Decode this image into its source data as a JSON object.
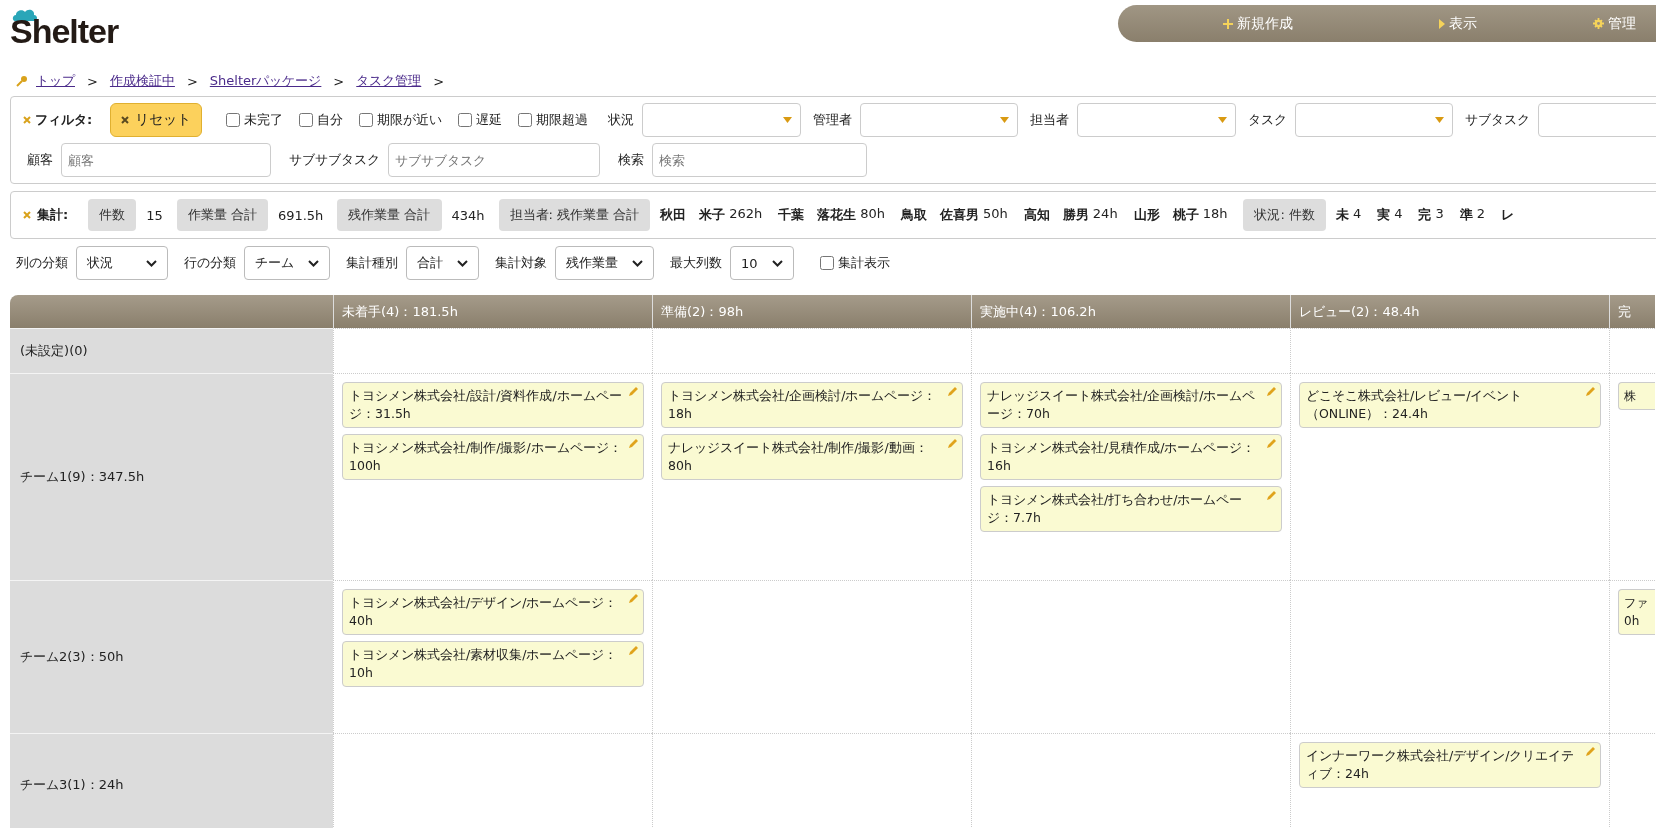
{
  "logo": "Shelter",
  "nav": [
    {
      "kind": "plus",
      "label": "新規作成"
    },
    {
      "kind": "triangle",
      "label": "表示"
    },
    {
      "kind": "gear",
      "label": "管理"
    }
  ],
  "breadcrumb": [
    {
      "label": "トップ",
      "separator": ">"
    },
    {
      "label": "作成検証中",
      "separator": ">"
    },
    {
      "label": "Shelterパッケージ",
      "separator": ">"
    },
    {
      "label": "タスク管理",
      "separator": ">"
    }
  ],
  "filter": {
    "title": "フィルタ:",
    "reset": "リセット",
    "checkboxes": [
      {
        "label": "未完了",
        "checked": false
      },
      {
        "label": "自分",
        "checked": false
      },
      {
        "label": "期限が近い",
        "checked": false
      },
      {
        "label": "遅延",
        "checked": false
      },
      {
        "label": "期限超過",
        "checked": false
      }
    ],
    "selects": [
      {
        "label": "状況"
      },
      {
        "label": "管理者"
      },
      {
        "label": "担当者"
      },
      {
        "label": "タスク"
      },
      {
        "label": "サブタスク"
      }
    ],
    "fields": [
      {
        "label": "顧客",
        "placeholder": "顧客"
      },
      {
        "label": "サブサブタスク",
        "placeholder": "サブサブタスク"
      },
      {
        "label": "検索",
        "placeholder": "検索"
      }
    ]
  },
  "summary": {
    "title": "集計:",
    "items": [
      {
        "kind": "tag",
        "text": "件数"
      },
      {
        "kind": "value",
        "text": "15"
      },
      {
        "kind": "tag",
        "text": "作業量 合計"
      },
      {
        "kind": "value",
        "text": "691.5h"
      },
      {
        "kind": "tag",
        "text": "残作業量 合計"
      },
      {
        "kind": "value",
        "text": "434h"
      },
      {
        "kind": "tag",
        "text": "担当者: 残作業量 合計"
      },
      {
        "kind": "pair",
        "name": "秋田　米子",
        "value": "262h"
      },
      {
        "kind": "pair",
        "name": "千葉　落花生",
        "value": "80h"
      },
      {
        "kind": "pair",
        "name": "鳥取　佐喜男",
        "value": "50h"
      },
      {
        "kind": "pair",
        "name": "高知　勝男",
        "value": "24h"
      },
      {
        "kind": "pair",
        "name": "山形　桃子",
        "value": "18h"
      },
      {
        "kind": "tag",
        "text": "状況: 件数"
      },
      {
        "kind": "pair",
        "name": "未",
        "value": "4"
      },
      {
        "kind": "pair",
        "name": "実",
        "value": "4"
      },
      {
        "kind": "pair",
        "name": "完",
        "value": "3"
      },
      {
        "kind": "pair",
        "name": "準",
        "value": "2"
      },
      {
        "kind": "pair",
        "name": "レ",
        "value": ""
      }
    ]
  },
  "options": [
    {
      "label": "列の分類",
      "value": "状況"
    },
    {
      "label": "行の分類",
      "value": "チーム"
    },
    {
      "label": "集計種別",
      "value": "合計"
    },
    {
      "label": "集計対象",
      "value": "残作業量"
    },
    {
      "label": "最大列数",
      "value": "10"
    }
  ],
  "show_totals": {
    "label": "集計表示",
    "checked": false
  },
  "board": {
    "columns": [
      "未着手(4)：181.5h",
      "準備(2)：98h",
      "実施中(4)：106.2h",
      "レビュー(2)：48.4h",
      "完"
    ],
    "rows": [
      {
        "label": "(未設定)(0)",
        "cells": [
          [],
          [],
          [],
          [],
          []
        ]
      },
      {
        "label": "チーム1(9)：347.5h",
        "cells": [
          [
            "トヨシメン株式会社/設計/資料作成/ホームページ：31.5h",
            "トヨシメン株式会社/制作/撮影/ホームページ：100h"
          ],
          [
            "トヨシメン株式会社/企画検討/ホームページ：18h",
            "ナレッジスイート株式会社/制作/撮影/動画：80h"
          ],
          [
            "ナレッジスイート株式会社/企画検討/ホームページ：70h",
            "トヨシメン株式会社/見積作成/ホームページ：16h",
            "トヨシメン株式会社/打ち合わせ/ホームページ：7.7h"
          ],
          [
            "どこそこ株式会社/レビュー/イベント（ONLINE）：24.4h"
          ],
          [
            "株"
          ]
        ]
      },
      {
        "label": "チーム2(3)：50h",
        "cells": [
          [
            "トヨシメン株式会社/デザイン/ホームページ：40h",
            "トヨシメン株式会社/素材収集/ホームページ：10h"
          ],
          [],
          [],
          [],
          [
            "ファ 0h"
          ]
        ]
      },
      {
        "label": "チーム3(1)：24h",
        "cells": [
          [],
          [],
          [],
          [
            "インナーワーク株式会社/デザイン/クリエイティブ：24h"
          ],
          []
        ]
      }
    ]
  }
}
